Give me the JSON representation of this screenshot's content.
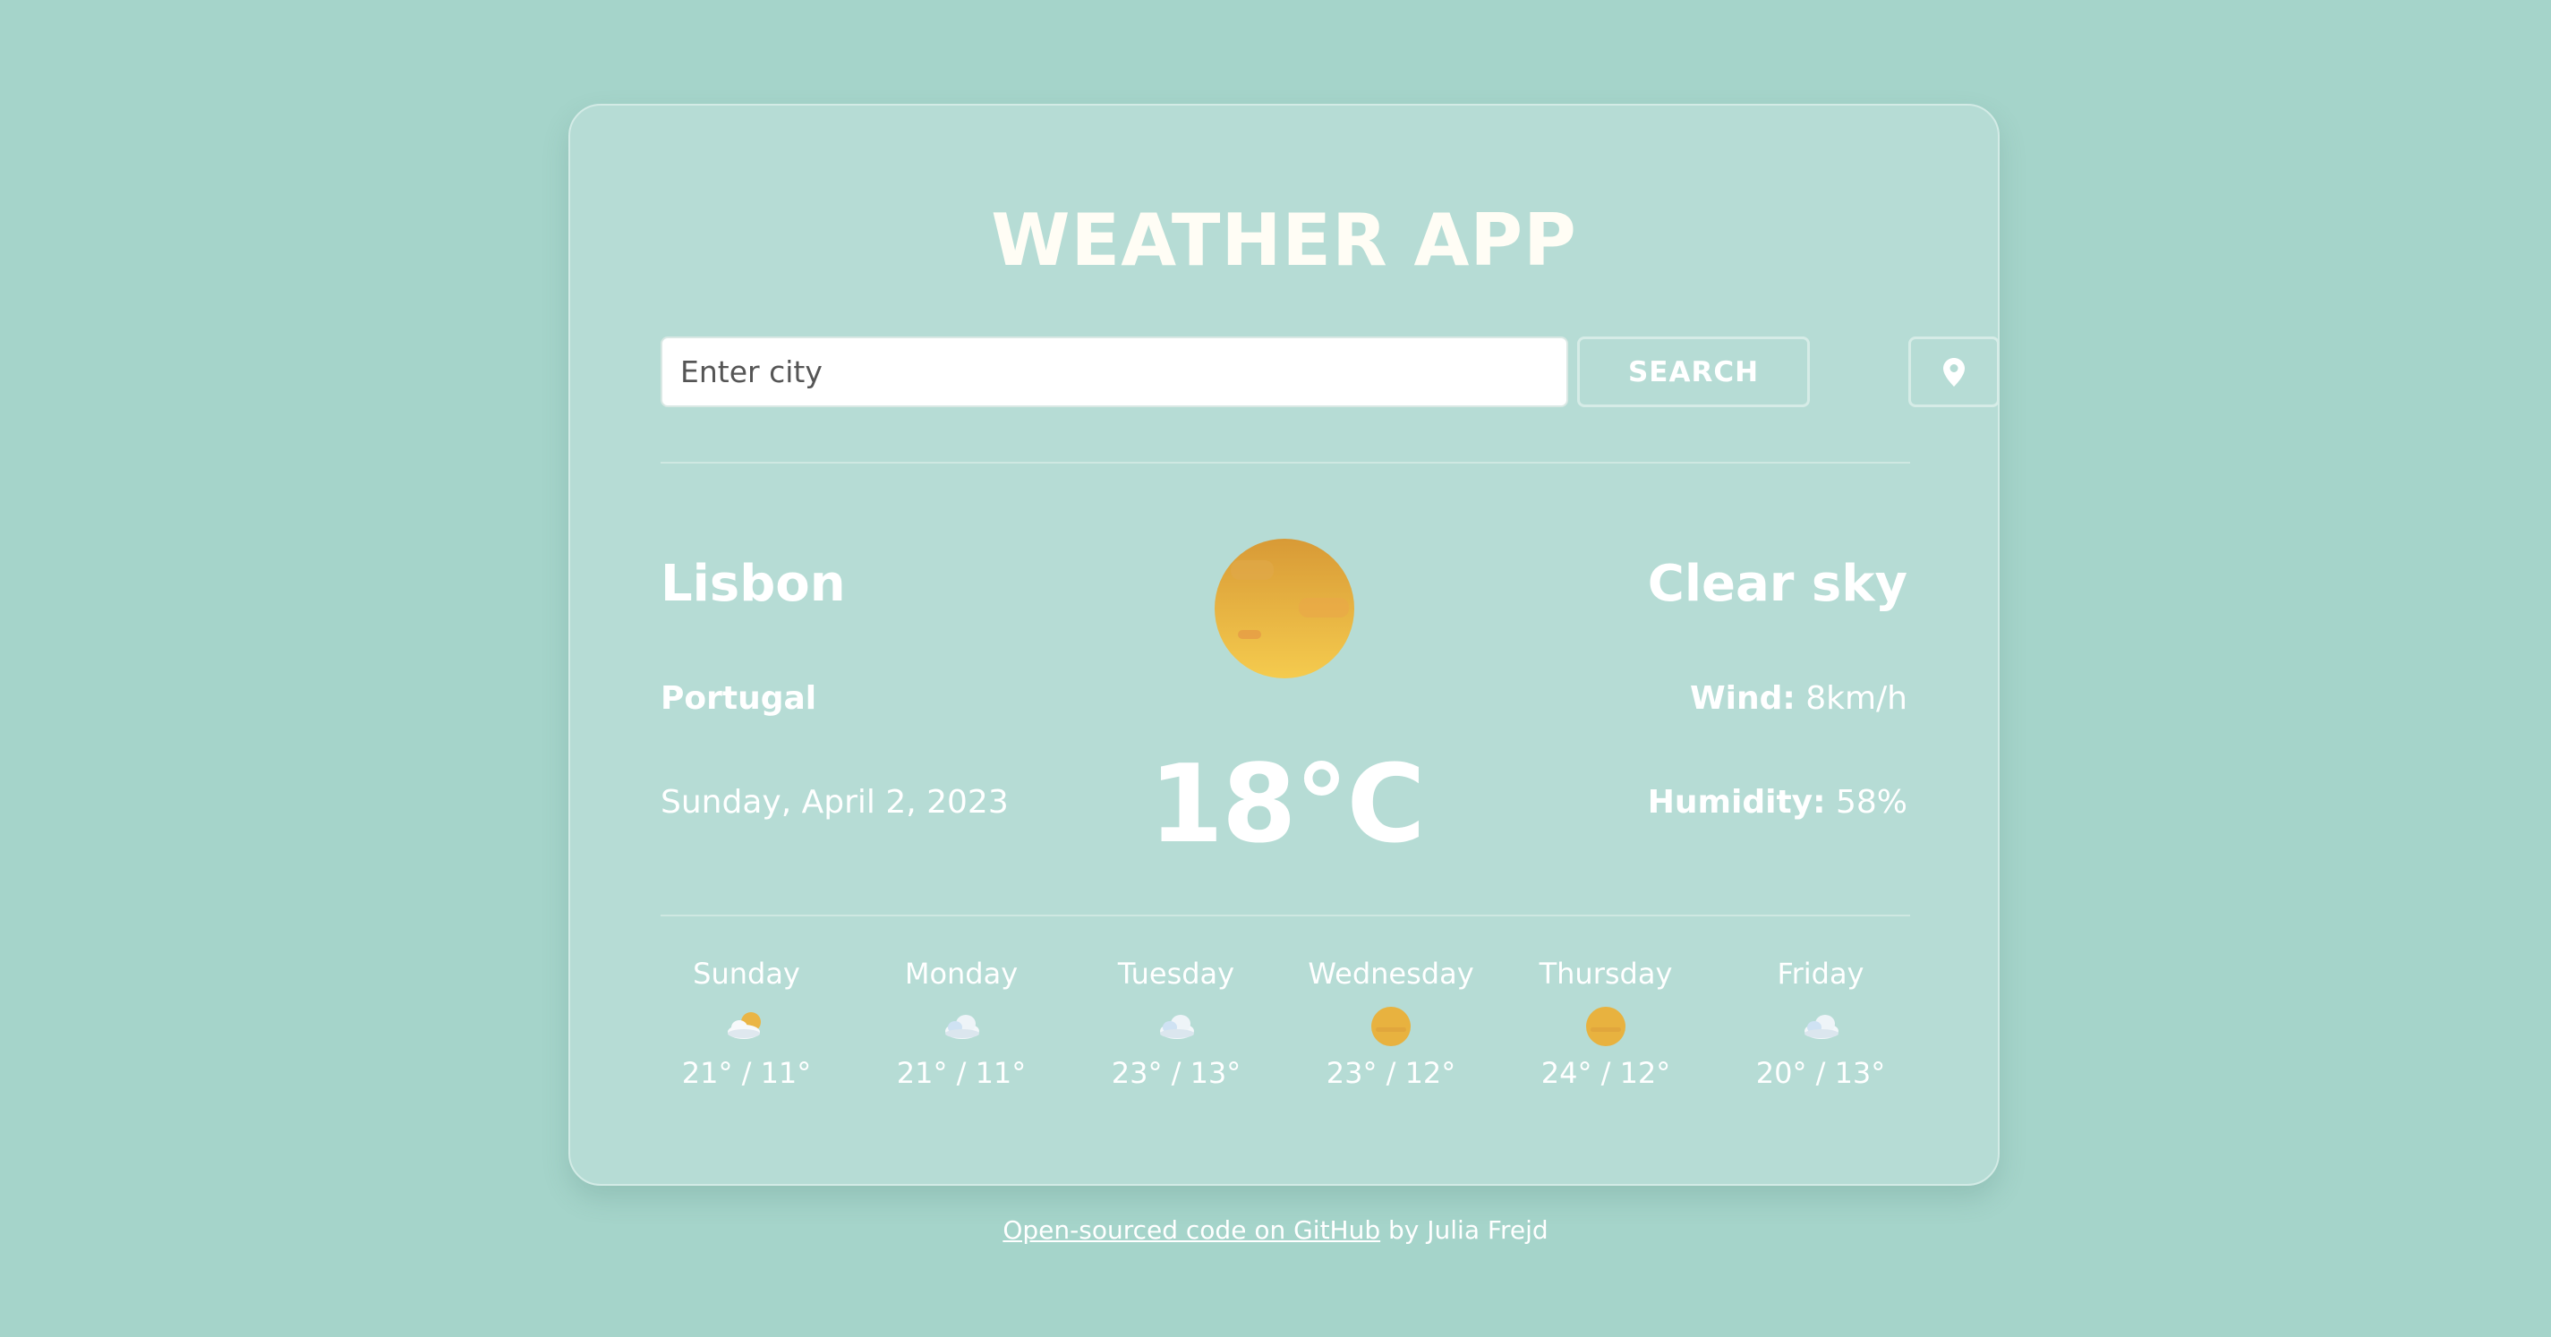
{
  "app": {
    "title": "WEATHER APP"
  },
  "search": {
    "placeholder": "Enter city",
    "button_label": "SEARCH",
    "location_icon": "map-pin-icon"
  },
  "current": {
    "city": "Lisbon",
    "country": "Portugal",
    "date": "Sunday, April 2, 2023",
    "temperature": "18°C",
    "description": "Clear sky",
    "icon": "sun-icon",
    "wind_label": "Wind:",
    "wind_value": "8km/h",
    "humidity_label": "Humidity:",
    "humidity_value": "58%"
  },
  "forecast": [
    {
      "day": "Sunday",
      "icon": "partly-cloudy-icon",
      "temps": "21° / 11°"
    },
    {
      "day": "Monday",
      "icon": "cloud-icon",
      "temps": "21° / 11°"
    },
    {
      "day": "Tuesday",
      "icon": "cloud-icon",
      "temps": "23° / 13°"
    },
    {
      "day": "Wednesday",
      "icon": "sun-icon",
      "temps": "23° / 12°"
    },
    {
      "day": "Thursday",
      "icon": "sun-icon",
      "temps": "24° / 12°"
    },
    {
      "day": "Friday",
      "icon": "cloud-icon",
      "temps": "20° / 13°"
    }
  ],
  "footer": {
    "link_text": "Open-sourced code on GitHub",
    "suffix": " by Julia Frejd"
  },
  "colors": {
    "background": "#a5d4ca",
    "card": "#b6dcd5",
    "sun": "#e9b53f",
    "text": "#ffffff"
  }
}
